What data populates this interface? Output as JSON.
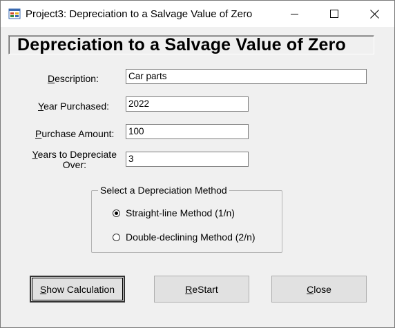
{
  "window": {
    "title": "Project3: Depreciation to a Salvage Value of Zero"
  },
  "header": {
    "title": "Depreciation to a Salvage Value of Zero"
  },
  "fields": {
    "description": {
      "label_mnemonic": "D",
      "label_rest": "escription:",
      "value": "Car parts"
    },
    "year": {
      "label_mnemonic": "Y",
      "label_rest": "ear Purchased:",
      "value": "2022"
    },
    "amount": {
      "label_mnemonic": "P",
      "label_rest": "urchase Amount:",
      "value": "100"
    },
    "years": {
      "label_mnemonic": "Y",
      "label_line1_rest": "ears to Depreciate",
      "label_line2": "Over:",
      "value": "3"
    }
  },
  "method": {
    "group_title": "Select a Depreciation Method",
    "options": [
      {
        "label": "Straight-line Method (1/n)",
        "selected": true
      },
      {
        "label": "Double-declining Method (2/n)",
        "selected": false
      }
    ]
  },
  "buttons": {
    "show": {
      "mnemonic": "S",
      "rest": "how Calculation"
    },
    "restart": {
      "mnemonic": "R",
      "rest": "eStart"
    },
    "close": {
      "mnemonic": "C",
      "rest": "lose"
    }
  },
  "colors": {
    "background": "#f0f0f0",
    "titlebar": "#ffffff",
    "text": "#000000"
  },
  "icons": {
    "app": "form-app-icon",
    "minimize": "minimize-icon",
    "maximize": "maximize-icon",
    "close": "close-x-icon"
  }
}
